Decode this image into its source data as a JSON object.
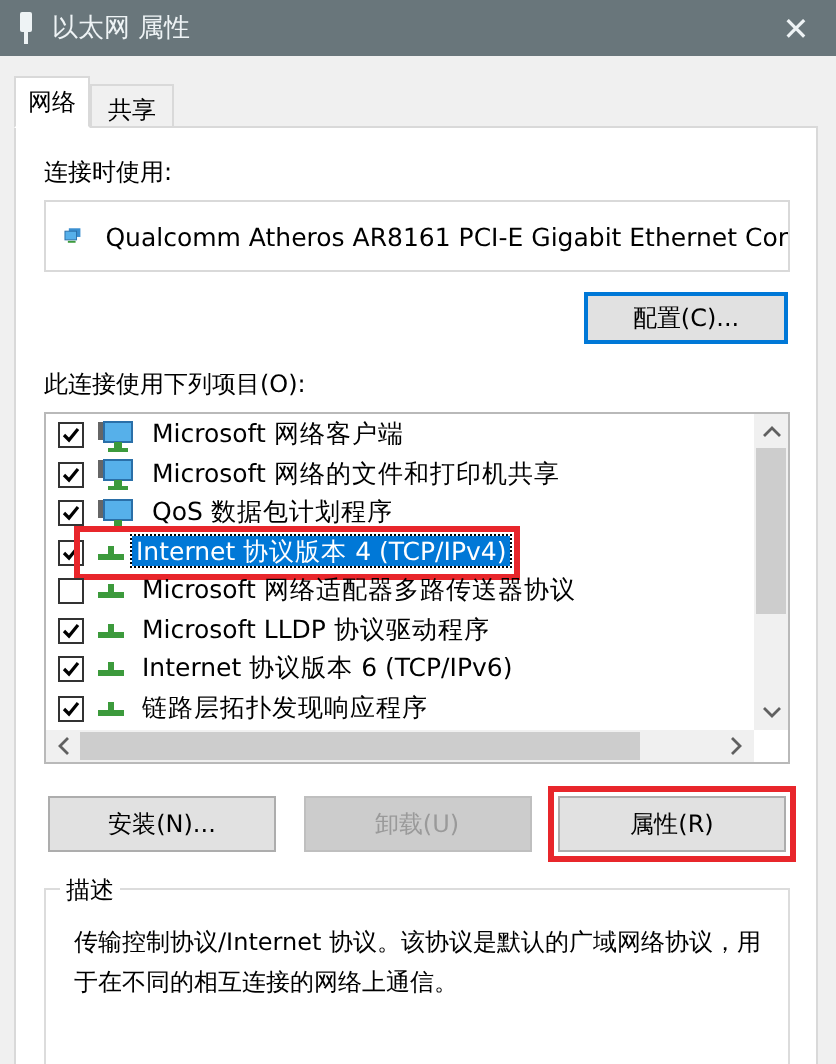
{
  "window": {
    "title": "以太网 属性",
    "close": "✕"
  },
  "tabs": [
    {
      "label": "网络",
      "selected": true
    },
    {
      "label": "共享",
      "selected": false
    }
  ],
  "connect_using": {
    "label": "连接时使用:",
    "adapter": "Qualcomm Atheros AR8161 PCI-E Gigabit Ethernet Cor",
    "configure_button": "配置(C)..."
  },
  "items_label": "此连接使用下列项目(O):",
  "items": [
    {
      "label": "Microsoft 网络客户端",
      "kind": "client",
      "checked": true,
      "selected": false,
      "highlighted": false
    },
    {
      "label": "Microsoft 网络的文件和打印机共享",
      "kind": "client",
      "checked": true,
      "selected": false,
      "highlighted": false
    },
    {
      "label": "QoS 数据包计划程序",
      "kind": "client",
      "checked": true,
      "selected": false,
      "highlighted": false
    },
    {
      "label": "Internet 协议版本 4 (TCP/IPv4)",
      "kind": "protocol",
      "checked": true,
      "selected": true,
      "highlighted": true
    },
    {
      "label": "Microsoft 网络适配器多路传送器协议",
      "kind": "protocol",
      "checked": false,
      "selected": false,
      "highlighted": false
    },
    {
      "label": "Microsoft LLDP 协议驱动程序",
      "kind": "protocol",
      "checked": true,
      "selected": false,
      "highlighted": false
    },
    {
      "label": "Internet 协议版本 6 (TCP/IPv6)",
      "kind": "protocol",
      "checked": true,
      "selected": false,
      "highlighted": false
    },
    {
      "label": "链路层拓扑发现响应程序",
      "kind": "protocol",
      "checked": true,
      "selected": false,
      "highlighted": false
    }
  ],
  "buttons": [
    {
      "label": "安装(N)...",
      "disabled": false,
      "highlighted": false
    },
    {
      "label": "卸载(U)",
      "disabled": true,
      "highlighted": false
    },
    {
      "label": "属性(R)",
      "disabled": false,
      "highlighted": true
    }
  ],
  "description": {
    "title": "描述",
    "text": "传输控制协议/Internet 协议。该协议是默认的广域网络协议，用于在不同的相互连接的网络上通信。"
  }
}
